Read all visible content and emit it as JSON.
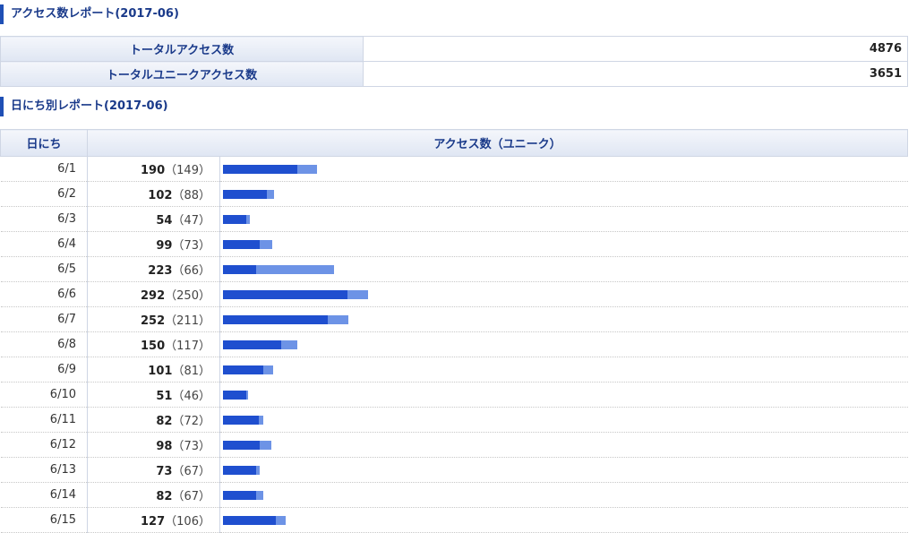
{
  "report": {
    "title": "アクセス数レポート(2017-06)",
    "summary": [
      {
        "label": "トータルアクセス数",
        "value": "4876"
      },
      {
        "label": "トータルユニークアクセス数",
        "value": "3651"
      }
    ]
  },
  "daily": {
    "title": "日にち別レポート(2017-06)",
    "headers": {
      "day": "日にち",
      "access": "アクセス数（ユニーク）"
    },
    "rows": [
      {
        "day": "6/1",
        "total": 190,
        "unique": 149
      },
      {
        "day": "6/2",
        "total": 102,
        "unique": 88
      },
      {
        "day": "6/3",
        "total": 54,
        "unique": 47
      },
      {
        "day": "6/4",
        "total": 99,
        "unique": 73
      },
      {
        "day": "6/5",
        "total": 223,
        "unique": 66
      },
      {
        "day": "6/6",
        "total": 292,
        "unique": 250
      },
      {
        "day": "6/7",
        "total": 252,
        "unique": 211
      },
      {
        "day": "6/8",
        "total": 150,
        "unique": 117
      },
      {
        "day": "6/9",
        "total": 101,
        "unique": 81
      },
      {
        "day": "6/10",
        "total": 51,
        "unique": 46
      },
      {
        "day": "6/11",
        "total": 82,
        "unique": 72
      },
      {
        "day": "6/12",
        "total": 98,
        "unique": 73
      },
      {
        "day": "6/13",
        "total": 73,
        "unique": 67
      },
      {
        "day": "6/14",
        "total": 82,
        "unique": 67
      },
      {
        "day": "6/15",
        "total": 127,
        "unique": 106
      }
    ]
  },
  "colors": {
    "total_bar": "#6d93e6",
    "unique_bar": "#1f4fcf",
    "accent": "#1f4fb5"
  }
}
